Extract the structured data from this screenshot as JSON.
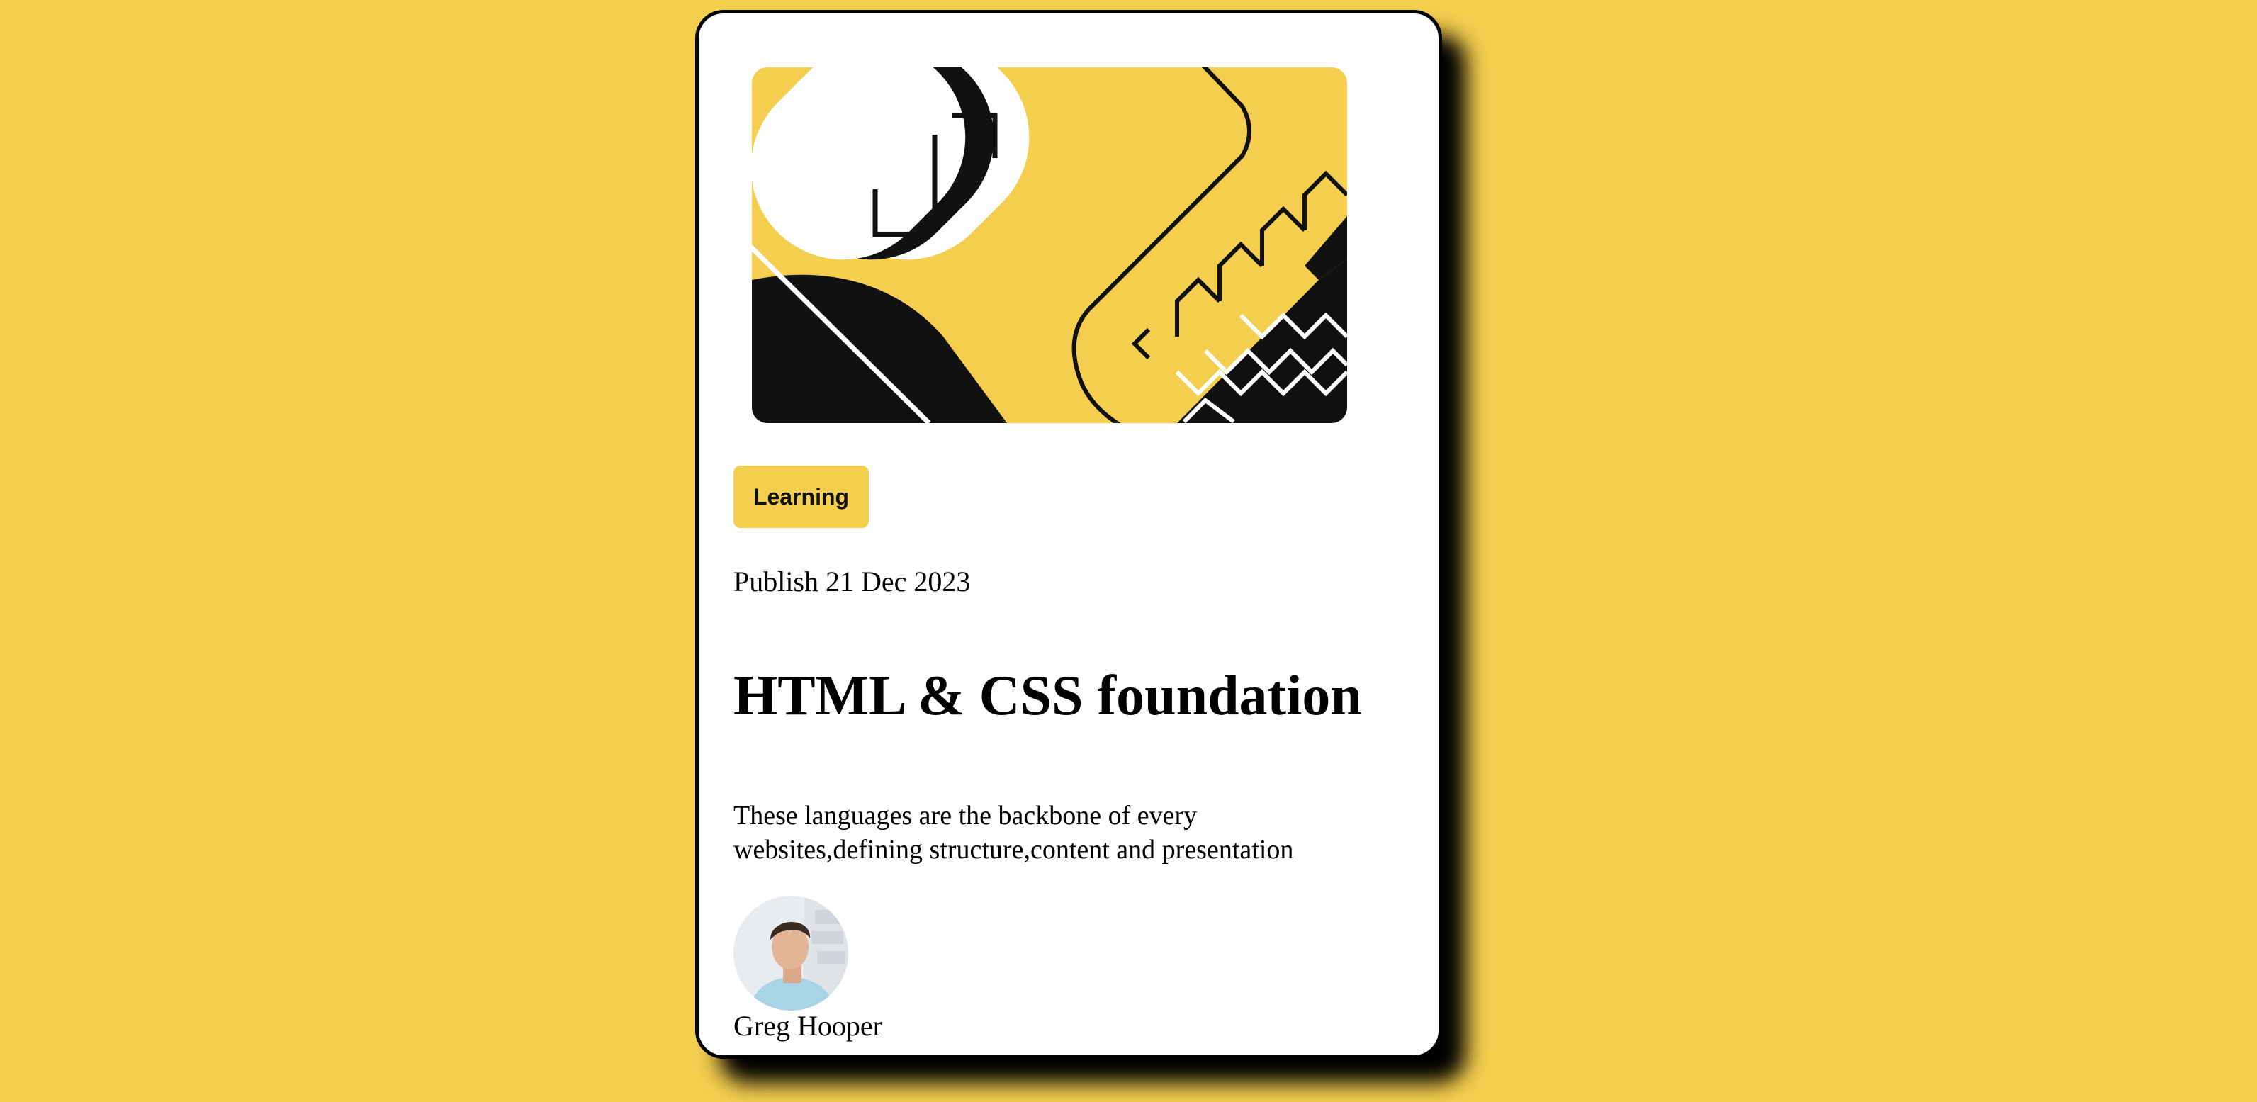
{
  "card": {
    "category": "Learning",
    "publish_date": "Publish 21 Dec 2023",
    "title": "HTML & CSS foundation",
    "description": "These languages are the backbone of every websites,defining structure,content and presentation",
    "author": {
      "name": "Greg Hooper"
    }
  },
  "colors": {
    "background": "#f4ce4f",
    "card": "#ffffff",
    "ink": "#111111",
    "accent": "#f4ce4f"
  },
  "icons": {
    "hero": "abstract-code-illustration",
    "avatar": "author-portrait"
  }
}
